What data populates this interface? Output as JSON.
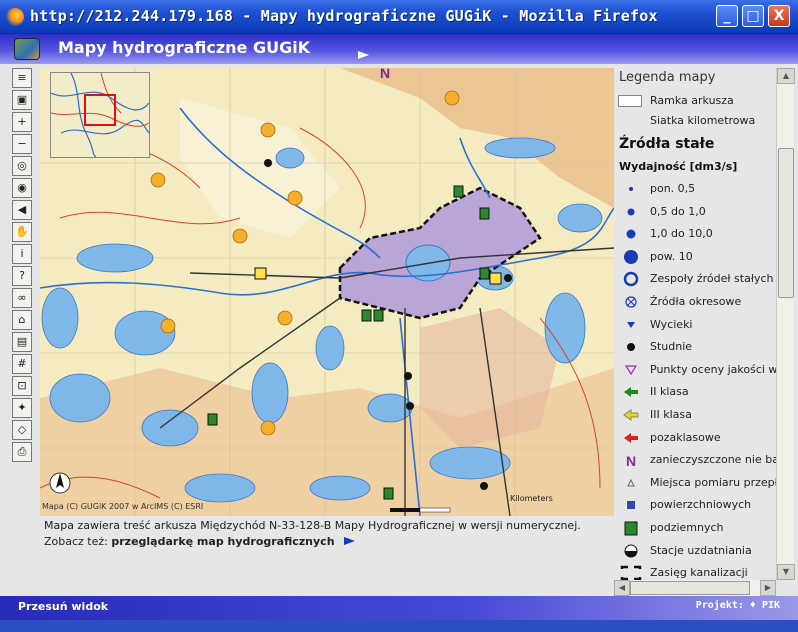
{
  "window": {
    "title": "http://212.244.179.168 - Mapy hydrograficzne GUGiK - Mozilla Firefox",
    "buttons": {
      "minimize": "_",
      "maximize": "□",
      "close": "X"
    }
  },
  "app": {
    "title": "Mapy hydrograficzne GUGiK"
  },
  "toolbar": {
    "tools": [
      {
        "name": "toc-tool",
        "glyph": "≡"
      },
      {
        "name": "overview-toggle-tool",
        "glyph": "▣"
      },
      {
        "name": "zoom-in-tool",
        "glyph": "+"
      },
      {
        "name": "zoom-out-tool",
        "glyph": "−"
      },
      {
        "name": "zoom-full-tool",
        "glyph": "◎"
      },
      {
        "name": "zoom-active-tool",
        "glyph": "◉"
      },
      {
        "name": "back-tool",
        "glyph": "◀"
      },
      {
        "name": "pan-tool",
        "glyph": "✋"
      },
      {
        "name": "identify-tool",
        "glyph": "i"
      },
      {
        "name": "hyperlink-tool",
        "glyph": "?"
      },
      {
        "name": "find-tool",
        "glyph": "∞"
      },
      {
        "name": "measure-tool",
        "glyph": "⌂"
      },
      {
        "name": "select-rect-tool",
        "glyph": "▤"
      },
      {
        "name": "select-poly-tool",
        "glyph": "#"
      },
      {
        "name": "select-point-tool",
        "glyph": "⊡"
      },
      {
        "name": "buffer-tool",
        "glyph": "✦"
      },
      {
        "name": "clear-selection-tool",
        "glyph": "◇"
      },
      {
        "name": "print-tool",
        "glyph": "⎙"
      }
    ]
  },
  "map": {
    "copyright": "Mapa (C) GUGiK 2007 w ArcIMS (C) ESRI",
    "scale_label": "Kilometers",
    "north_arrow": "north-arrow-icon"
  },
  "info": {
    "line1": "Mapa zawiera treść arkusza Międzychód N-33-128-B Mapy Hydrograficznej w wersji numerycznej.",
    "line2_prefix": "Zobacz też:",
    "line2_link": "przeglądarkę map hydrograficznych"
  },
  "legend": {
    "title": "Legenda mapy",
    "frame_label": "Ramka arkusza",
    "grid_label": "Siatka kilometrowa",
    "section1": "Źródła stałe",
    "section2": "Wydajność [dm3/s]",
    "items": [
      "pon. 0,5",
      "0,5 do 1,0",
      "1,0 do 10,0",
      "pow. 10",
      "Zespoły źródeł stałych",
      "Źródła okresowe",
      "Wycieki",
      "Studnie",
      "Punkty oceny jakości w",
      "II klasa",
      "III klasa",
      "pozaklasowe",
      "zanieczyszczone nie ba",
      "Miejsca pomiaru przepły",
      "powierzchniowych",
      "podziemnych",
      "Stacje uzdatniania",
      "Zasięg kanalizacji"
    ]
  },
  "status": {
    "left": "Przesuń widok",
    "right": "Projekt: ♦ PIK"
  },
  "colors": {
    "titlebar": "#1d4fd0",
    "app_header": "#3d3dd0",
    "map_background": "#f4ecc0",
    "lakes": "#7fb8e8",
    "urban": "#b9a6d6",
    "rivers": "#2a6fd0"
  }
}
